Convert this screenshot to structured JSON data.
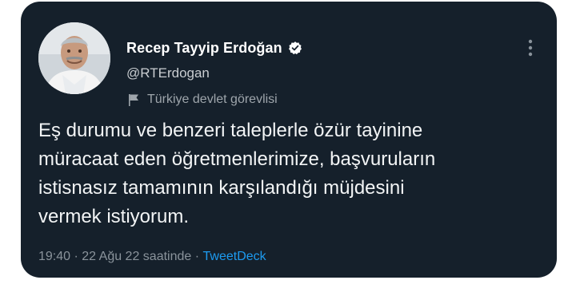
{
  "user": {
    "display_name": "Recep Tayyip Erdoğan",
    "handle": "@RTErdogan",
    "account_label": "Türkiye devlet görevlisi",
    "verified_icon": "verified-badge-icon",
    "label_icon": "flag-icon"
  },
  "tweet": {
    "text": "Eş durumu ve benzeri taleplerle özür tayinine\nmüracaat eden öğretmenlerimize, başvuruların\nistisnasız tamamının karşılandığı müjdesini\nvermek istiyorum.",
    "time": "19:40",
    "separator": "·",
    "date": "22 Ağu 22 saatinde",
    "source": "TweetDeck"
  },
  "colors": {
    "card_background": "#15202b",
    "link": "#1d9bf0",
    "secondary_text": "#8a939b"
  }
}
